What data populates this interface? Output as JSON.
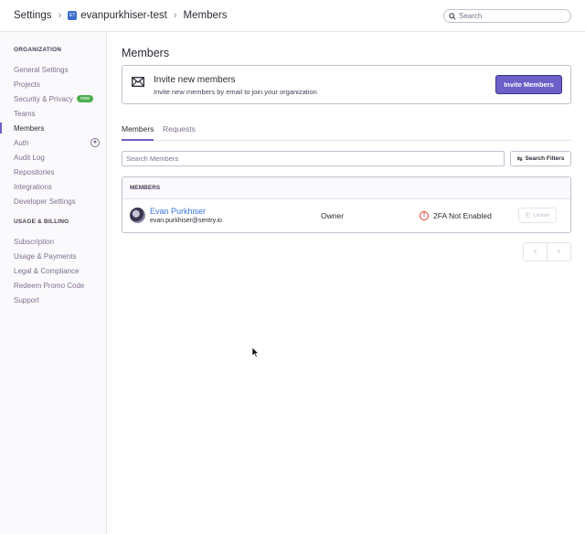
{
  "header": {
    "breadcrumbs": [
      "Settings",
      "evanpurkhiser-test",
      "Members"
    ],
    "org_badge": "ET",
    "search_placeholder": "Search"
  },
  "sidebar": {
    "sections": [
      {
        "heading": "ORGANIZATION",
        "items": [
          {
            "label": "General Settings"
          },
          {
            "label": "Projects"
          },
          {
            "label": "Security & Privacy",
            "badge": "new"
          },
          {
            "label": "Teams"
          },
          {
            "label": "Members",
            "active": true
          },
          {
            "label": "Auth"
          },
          {
            "label": "Audit Log"
          },
          {
            "label": "Repositories"
          },
          {
            "label": "Integrations"
          },
          {
            "label": "Developer Settings"
          }
        ]
      },
      {
        "heading": "USAGE & BILLING",
        "items": [
          {
            "label": "Subscription"
          },
          {
            "label": "Usage & Payments"
          },
          {
            "label": "Legal & Compliance"
          },
          {
            "label": "Redeem Promo Code"
          },
          {
            "label": "Support"
          }
        ]
      }
    ]
  },
  "main": {
    "title": "Members",
    "invite": {
      "title": "Invite new members",
      "subtitle": "Invite new members by email to join your organization",
      "button": "Invite Members"
    },
    "tabs": [
      "Members",
      "Requests"
    ],
    "search_placeholder": "Search Members",
    "filters_button": "Search Filters",
    "panel_header": "MEMBERS",
    "members": [
      {
        "name": "Evan Purkhiser",
        "email": "evan.purkhiser@sentry.io",
        "role": "Owner",
        "twofa": "2FA Not Enabled",
        "action": "Leave"
      }
    ],
    "pager": {
      "prev": "‹",
      "next": "›"
    }
  },
  "colors": {
    "accent": "#6c5fc7",
    "link": "#3d74db",
    "warning": "#e03e2f",
    "new_badge": "#4dae4f"
  }
}
